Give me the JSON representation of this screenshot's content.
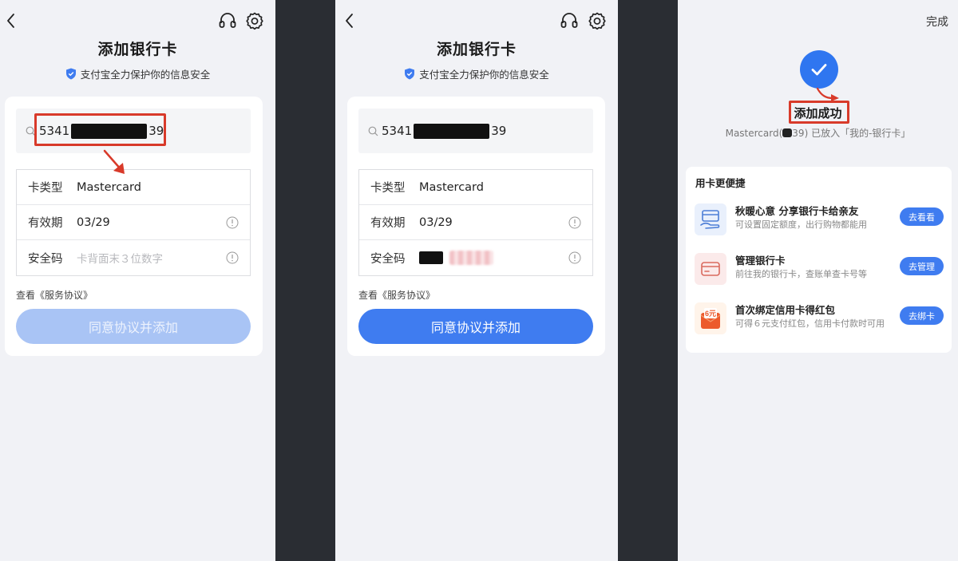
{
  "colors": {
    "accent": "#3f7cf0",
    "highlight": "#d83a2a",
    "panel_bg": "#f1f2f6",
    "divider_bg": "#2a2d33"
  },
  "screen1": {
    "title": "添加银行卡",
    "security_note": "支付宝全力保护你的信息安全",
    "card_prefix": "5341",
    "card_suffix": "39",
    "rows": {
      "type_label": "卡类型",
      "type_value": "Mastercard",
      "expiry_label": "有效期",
      "expiry_value": "03/29",
      "cvv_label": "安全码",
      "cvv_placeholder": "卡背面末３位数字"
    },
    "agreement": "查看《服务协议》",
    "submit": "同意协议并添加"
  },
  "screen2": {
    "title": "添加银行卡",
    "security_note": "支付宝全力保护你的信息安全",
    "card_prefix": "5341",
    "card_suffix": "39",
    "rows": {
      "type_label": "卡类型",
      "type_value": "Mastercard",
      "expiry_label": "有效期",
      "expiry_value": "03/29",
      "cvv_label": "安全码"
    },
    "agreement": "查看《服务协议》",
    "submit": "同意协议并添加"
  },
  "screen3": {
    "done": "完成",
    "success_title": "添加成功",
    "success_note_prefix": "Mastercard(",
    "success_note_suffix": "39) 已放入「我的-银行卡」",
    "section_title": "用卡更便捷",
    "items": [
      {
        "title": "秋暖心意 分享银行卡给亲友",
        "desc": "可设置固定额度，出行购物都能用",
        "button": "去看看",
        "icon": "hand-card-icon"
      },
      {
        "title": "管理银行卡",
        "desc": "前往我的银行卡，查账单查卡号等",
        "button": "去管理",
        "icon": "wallet-card-icon"
      },
      {
        "title": "首次绑定信用卡得红包",
        "desc": "可得６元支付红包，信用卡付款时可用",
        "button": "去绑卡",
        "icon": "red-envelope-icon",
        "badge": "6元"
      }
    ]
  }
}
